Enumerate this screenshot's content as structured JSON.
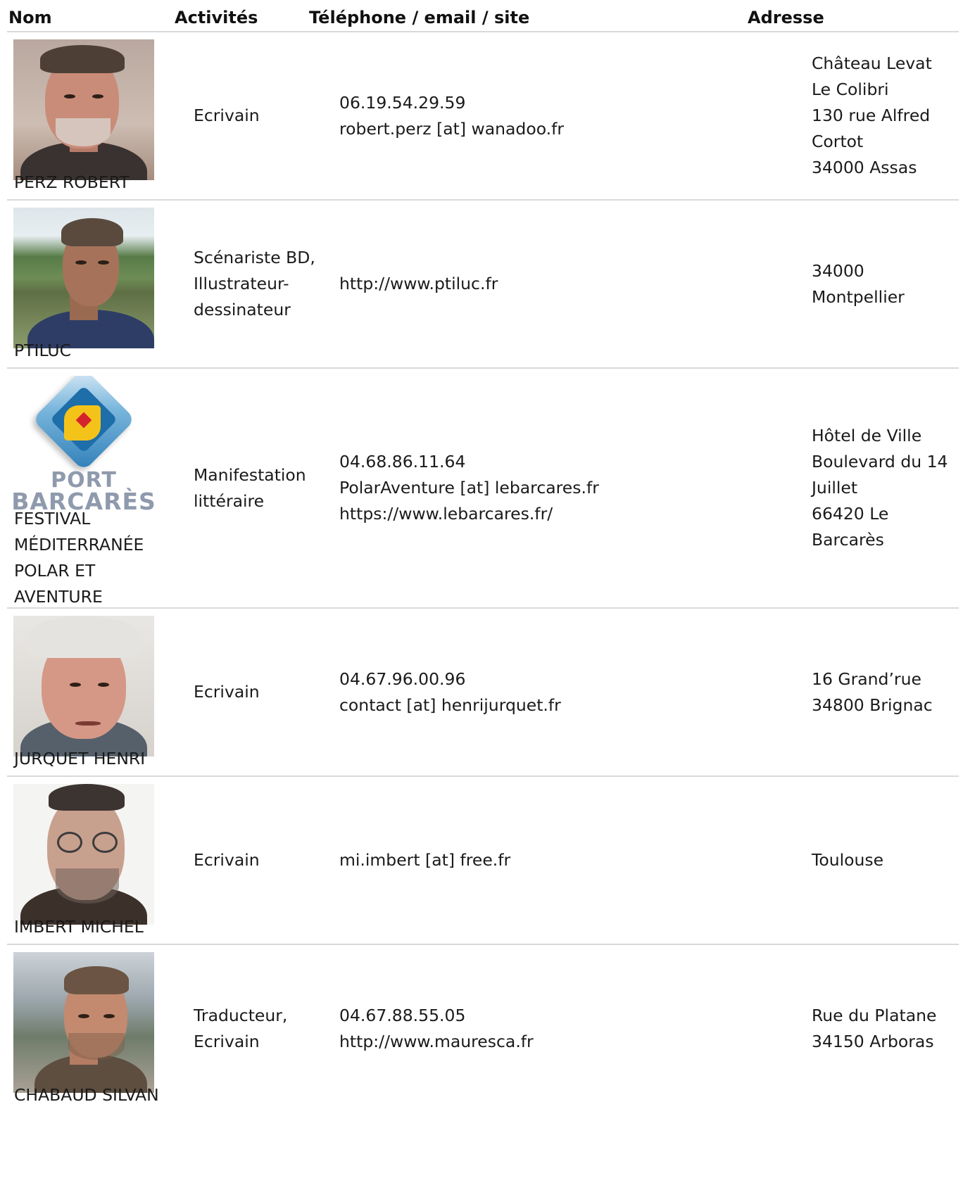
{
  "header": {
    "nom": "Nom",
    "activites": "Activités",
    "contact": "Téléphone / email / site",
    "adresse": "Adresse"
  },
  "rows": [
    {
      "name": "PERZ ROBERT",
      "photo_icon": "portrait-photo",
      "activity": "Ecrivain",
      "contact": "06.19.54.29.59\nrobert.perz [at] wanadoo.fr",
      "address": "Château Levat\nLe Colibri\n130 rue Alfred\nCortot\n34000 Assas"
    },
    {
      "name": "PTILUC",
      "photo_icon": "portrait-photo",
      "activity": "Scénariste BD,\nIllustrateur-\ndessinateur",
      "contact": "http://www.ptiluc.fr",
      "address": "34000\nMontpellier"
    },
    {
      "name": "FESTIVAL\nMÉDITERRANÉE\nPOLAR ET\nAVENTURE",
      "photo_icon": "port-barcares-logo",
      "logo_top": "PORT",
      "logo_bottom": "BARCARÈS",
      "activity": "Manifestation\nlittéraire",
      "contact": "04.68.86.11.64\nPolarAventure [at] lebarcares.fr\nhttps://www.lebarcares.fr/",
      "address": "Hôtel de Ville\nBoulevard du 14\nJuillet\n66420 Le\nBarcarès"
    },
    {
      "name": "JURQUET HENRI",
      "photo_icon": "portrait-photo",
      "activity": "Ecrivain",
      "contact": "04.67.96.00.96\ncontact [at] henrijurquet.fr",
      "address": "16 Grand’rue\n34800 Brignac"
    },
    {
      "name": "IMBERT MICHEL",
      "photo_icon": "portrait-photo",
      "activity": "Ecrivain",
      "contact": "mi.imbert [at] free.fr",
      "address": "Toulouse"
    },
    {
      "name": "CHABAUD SILVAN",
      "photo_icon": "portrait-photo",
      "activity": "Traducteur,\nEcrivain",
      "contact": "04.67.88.55.05\nhttp://www.mauresca.fr",
      "address": "Rue du Platane\n34150 Arboras"
    }
  ],
  "colors": {
    "divider": "#d9d9d9",
    "text": "#1a1a1a"
  }
}
